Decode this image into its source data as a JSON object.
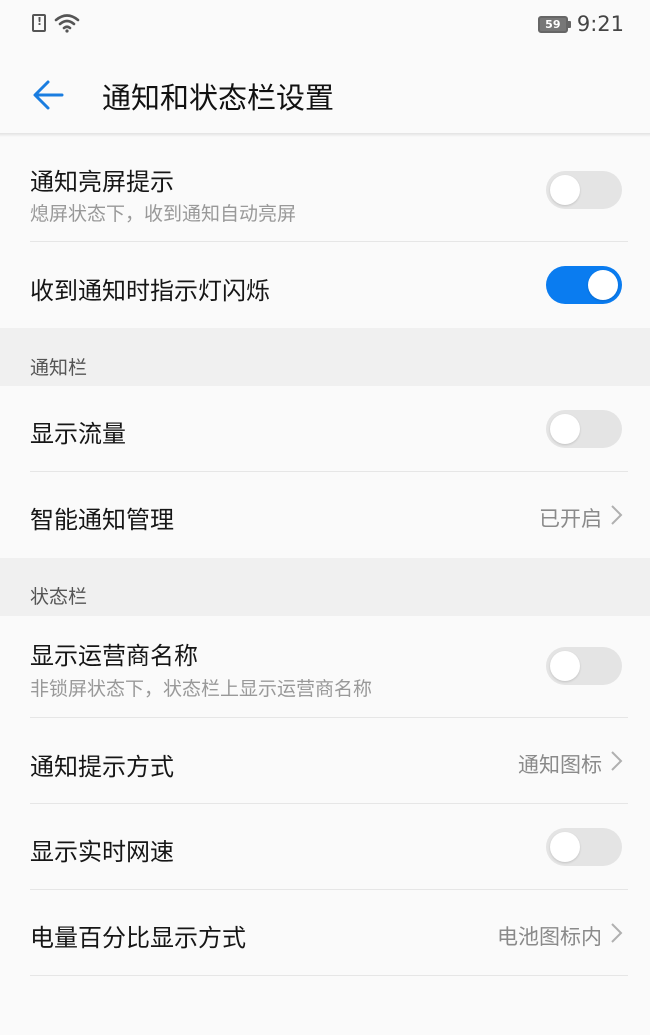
{
  "status_bar": {
    "time": "9:21",
    "battery": "59"
  },
  "header": {
    "title": "通知和状态栏设置"
  },
  "rows": {
    "wake_screen": {
      "title": "通知亮屏提示",
      "subtitle": "熄屏状态下，收到通知自动亮屏",
      "on": false
    },
    "indicator_light": {
      "title": "收到通知时指示灯闪烁",
      "on": true
    },
    "show_traffic": {
      "title": "显示流量",
      "on": false
    },
    "smart_notify": {
      "title": "智能通知管理",
      "value": "已开启"
    },
    "carrier_name": {
      "title": "显示运营商名称",
      "subtitle": "非锁屏状态下，状态栏上显示运营商名称",
      "on": false
    },
    "notify_style": {
      "title": "通知提示方式",
      "value": "通知图标"
    },
    "net_speed": {
      "title": "显示实时网速",
      "on": false
    },
    "battery_percent": {
      "title": "电量百分比显示方式",
      "value": "电池图标内"
    }
  },
  "sections": {
    "notification_bar": "通知栏",
    "status_bar": "状态栏"
  },
  "colors": {
    "accent": "#0a7cf0",
    "toggle_off": "#e4e4e4"
  },
  "icons": [
    "sim-icon",
    "wifi-icon",
    "battery-icon",
    "back-arrow-icon",
    "chevron-right-icon"
  ]
}
